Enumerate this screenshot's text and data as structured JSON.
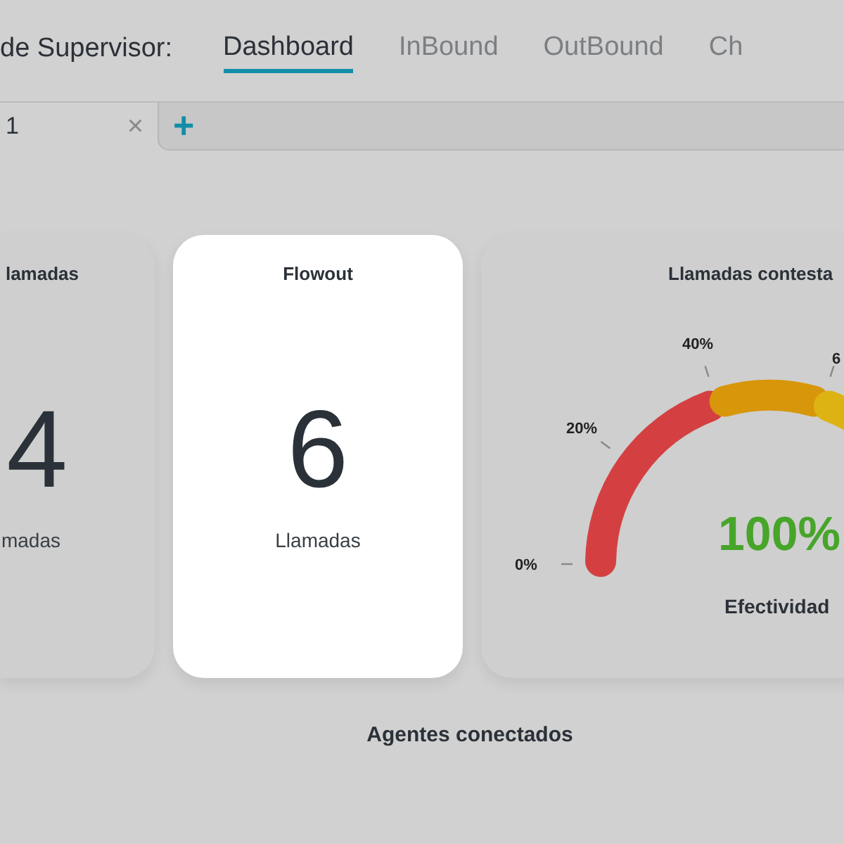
{
  "header": {
    "title": "de Supervisor:",
    "tabs": [
      {
        "label": "Dashboard",
        "selected": true
      },
      {
        "label": "InBound",
        "selected": false
      },
      {
        "label": "OutBound",
        "selected": false
      },
      {
        "label": "Ch",
        "selected": false
      }
    ]
  },
  "doc_tabs": {
    "tabs": [
      {
        "label": "1",
        "close": "×",
        "selected": true
      }
    ],
    "add": "+"
  },
  "cards": [
    {
      "kind": "count",
      "title": "lamadas",
      "value": "4",
      "unit": "madas",
      "highlighted": false
    },
    {
      "kind": "count",
      "title": "Flowout",
      "value": "6",
      "unit": "Llamadas",
      "highlighted": true
    },
    {
      "kind": "gauge",
      "title": "Llamadas contesta",
      "ticks": [
        "0%",
        "20%",
        "40%",
        "6"
      ],
      "value": "100%",
      "caption": "Efectividad",
      "highlighted": false
    }
  ],
  "section_title": "Agentes conectados"
}
